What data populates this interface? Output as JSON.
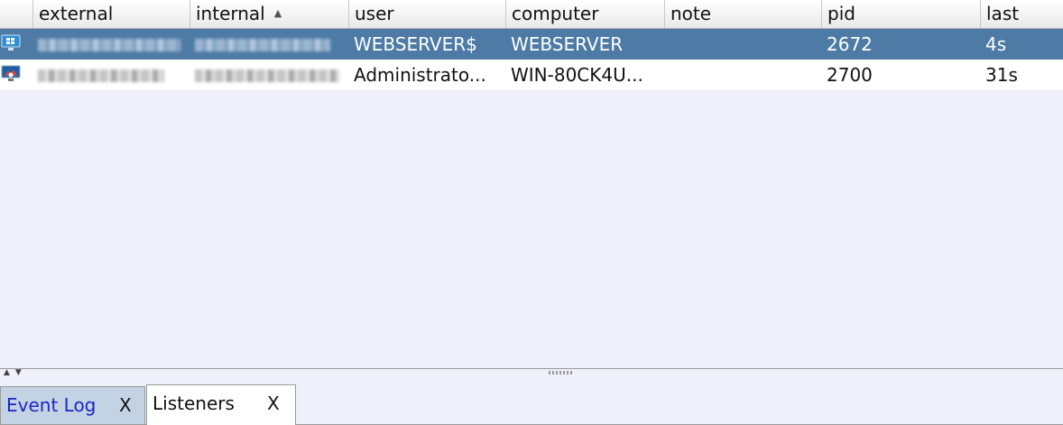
{
  "table": {
    "columns": [
      {
        "key": "icon",
        "label": ""
      },
      {
        "key": "external",
        "label": "external"
      },
      {
        "key": "internal",
        "label": "internal",
        "sorted": "ascending"
      },
      {
        "key": "user",
        "label": "user"
      },
      {
        "key": "computer",
        "label": "computer"
      },
      {
        "key": "note",
        "label": "note"
      },
      {
        "key": "pid",
        "label": "pid"
      },
      {
        "key": "last",
        "label": "last"
      }
    ],
    "rows": [
      {
        "icon": "windows-session-icon",
        "user": "WEBSERVER$",
        "computer": "WEBSERVER",
        "note": "",
        "pid": "2672",
        "last": "4s",
        "selected": true
      },
      {
        "icon": "admin-session-icon",
        "user": "Administrato...",
        "computer": "WIN-80CK4U...",
        "note": "",
        "pid": "2700",
        "last": "31s",
        "selected": false
      }
    ]
  },
  "tabs": [
    {
      "label": "Event Log",
      "close": "X",
      "active": false
    },
    {
      "label": "Listeners",
      "close": "X",
      "active": true
    }
  ],
  "colors": {
    "selected_row": "#4d7ba5",
    "event_log_tab_text": "#1a26c8",
    "panel_background": "#eef0fa"
  }
}
